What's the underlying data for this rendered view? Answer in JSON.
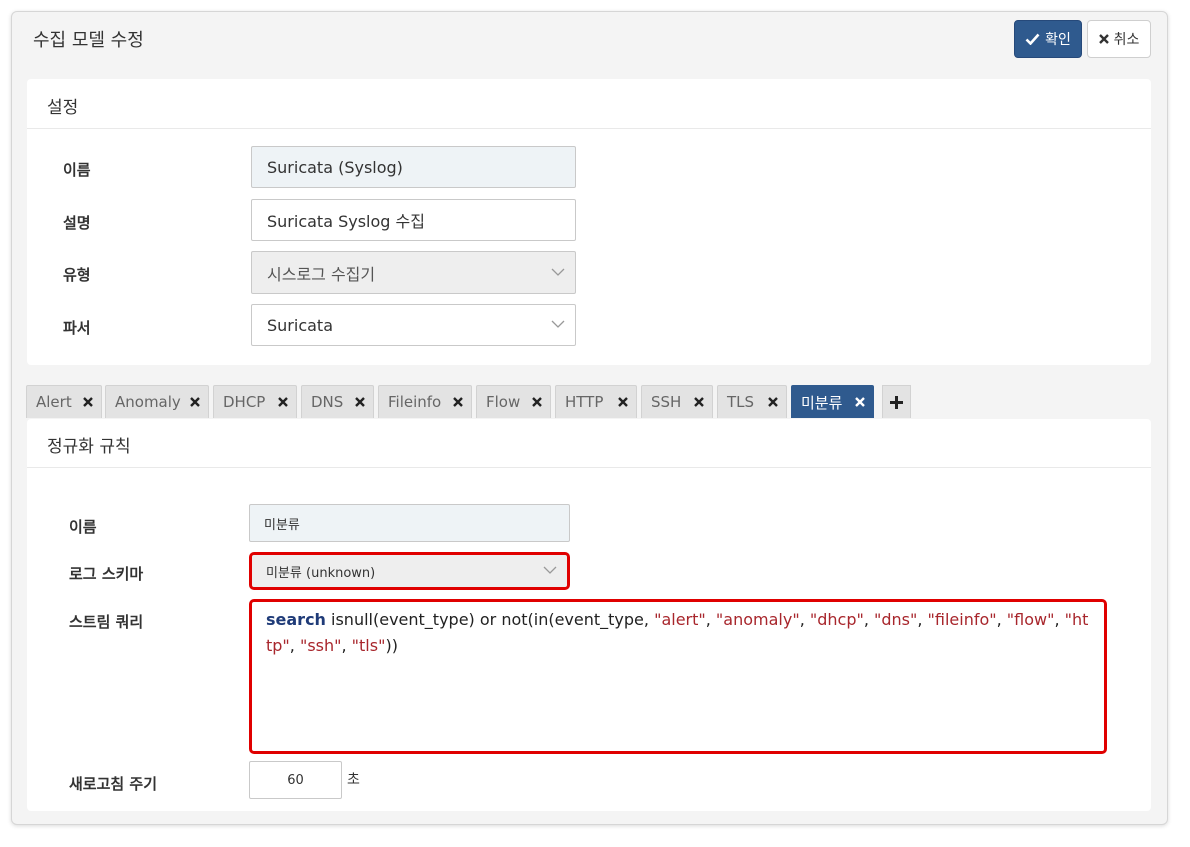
{
  "dialog": {
    "title": "수집 모델 수정",
    "ok_label": "확인",
    "cancel_label": "취소"
  },
  "settings": {
    "heading": "설정",
    "name_label": "이름",
    "name_value": "Suricata (Syslog)",
    "desc_label": "설명",
    "desc_value": "Suricata Syslog 수집",
    "type_label": "유형",
    "type_value": "시스로그 수집기",
    "parser_label": "파서",
    "parser_value": "Suricata"
  },
  "tabs": [
    {
      "label": "Alert"
    },
    {
      "label": "Anomaly"
    },
    {
      "label": "DHCP"
    },
    {
      "label": "DNS"
    },
    {
      "label": "Fileinfo"
    },
    {
      "label": "Flow"
    },
    {
      "label": "HTTP"
    },
    {
      "label": "SSH"
    },
    {
      "label": "TLS"
    },
    {
      "label": "미분류"
    }
  ],
  "active_tab": "미분류",
  "rule": {
    "heading": "정규화 규칙",
    "name_label": "이름",
    "name_value": "미분류",
    "schema_label": "로그 스키마",
    "schema_value": "미분류 (unknown)",
    "query_label": "스트림 쿼리",
    "query_keyword": "search",
    "query_text": " isnull(event_type) or not(in(event_type, ",
    "query_strings": [
      "\"alert\"",
      "\"anomaly\"",
      "\"dhcp\"",
      "\"dns\"",
      "\"fileinfo\"",
      "\"flow\"",
      "\"http\"",
      "\"ssh\"",
      "\"tls\""
    ],
    "query_sep": ", ",
    "query_end": "))",
    "refresh_label": "새로고침 주기",
    "refresh_value": "60",
    "refresh_unit": "초"
  },
  "colors": {
    "primary": "#2f5a8e",
    "highlight": "#e00000",
    "keyword": "#1f3b78",
    "string": "#a8262c"
  }
}
